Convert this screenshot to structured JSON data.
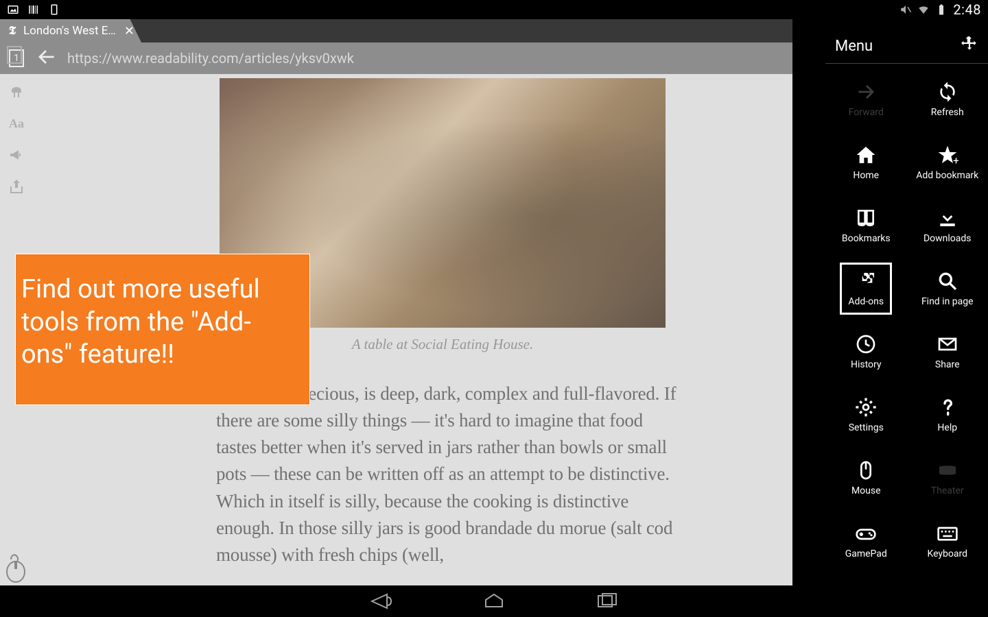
{
  "status": {
    "clock": "2:48"
  },
  "tab": {
    "title": "London's West E…"
  },
  "url": "https://www.readability.com/articles/yksv0xwk",
  "tabCount": "1",
  "article": {
    "caption": "A table at Social Eating House.",
    "body": ", not at all precious, is deep, dark, complex and full-flavored. If there are some silly things — it's hard to imagine that food tastes better when it's served in jars rather than bowls or small pots — these can be written off as an attempt to be distinctive. Which in itself is silly, because the cooking is distinctive enough. In those silly jars is good brandade du morue (salt cod mousse) with fresh chips (well,"
  },
  "callout": {
    "text": "Find out more useful tools from the \"Add-ons\" feature!!"
  },
  "menu": {
    "title": "Menu",
    "items": [
      {
        "label": "Forward",
        "icon": "forward",
        "disabled": true
      },
      {
        "label": "Refresh",
        "icon": "refresh"
      },
      {
        "label": "Home",
        "icon": "home"
      },
      {
        "label": "Add bookmark",
        "icon": "star-plus"
      },
      {
        "label": "Bookmarks",
        "icon": "book"
      },
      {
        "label": "Downloads",
        "icon": "download"
      },
      {
        "label": "Add-ons",
        "icon": "puzzle",
        "highlighted": true
      },
      {
        "label": "Find in page",
        "icon": "search"
      },
      {
        "label": "History",
        "icon": "clock"
      },
      {
        "label": "Share",
        "icon": "mail"
      },
      {
        "label": "Settings",
        "icon": "gear"
      },
      {
        "label": "Help",
        "icon": "help"
      },
      {
        "label": "Mouse",
        "icon": "mouse"
      },
      {
        "label": "Theater",
        "icon": "theater",
        "disabled": true
      },
      {
        "label": "GamePad",
        "icon": "gamepad"
      },
      {
        "label": "Keyboard",
        "icon": "keyboard"
      }
    ]
  }
}
